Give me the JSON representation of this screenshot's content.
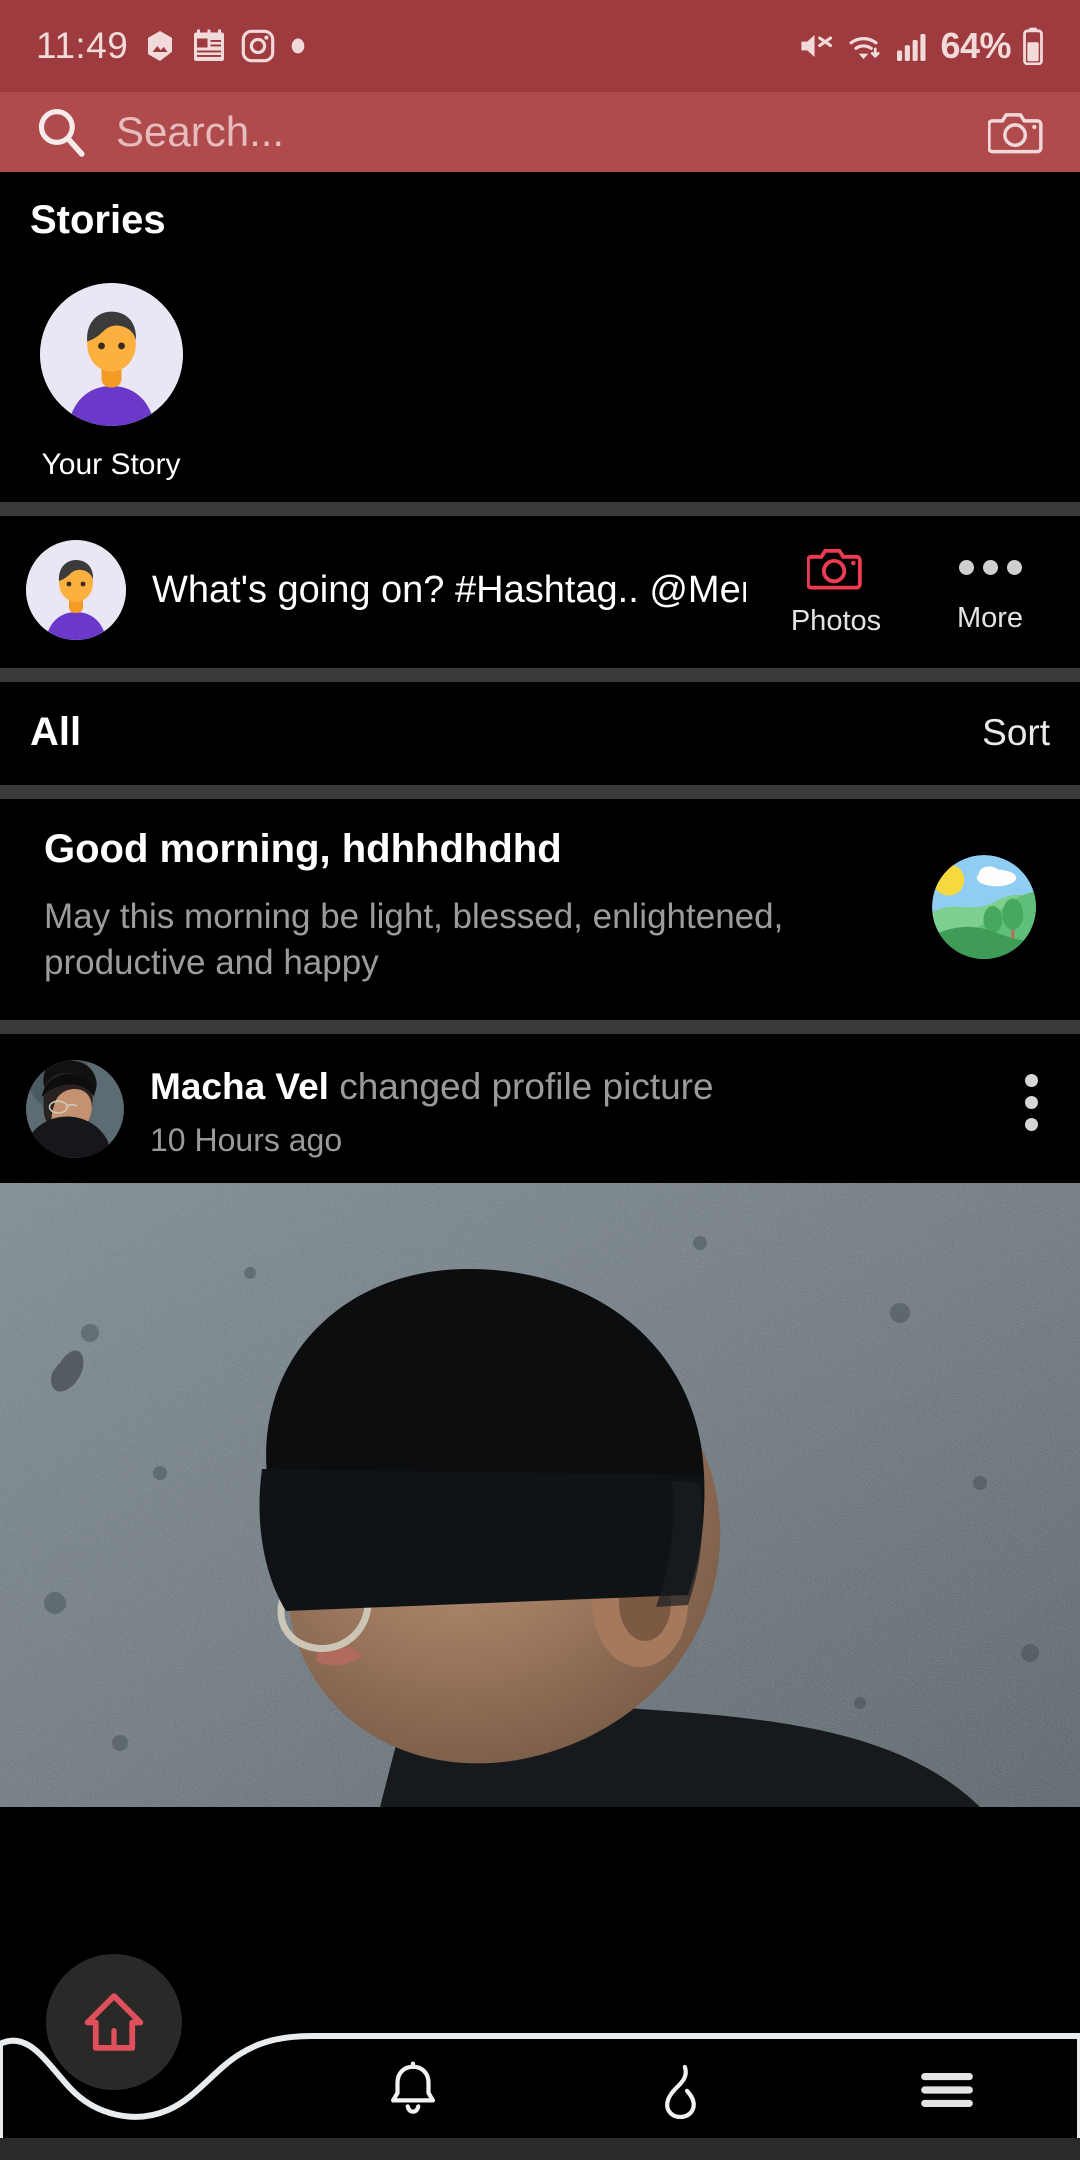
{
  "status_bar": {
    "time": "11:49",
    "battery_text": "64%",
    "left_icons": [
      "gallery-app-icon",
      "notes-app-icon",
      "instagram-app-icon",
      "dot-indicator-icon"
    ],
    "right_icons": [
      "mute-icon",
      "wifi-icon",
      "cellular-signal-icon",
      "battery-icon"
    ],
    "background_color": "#9e3b3e"
  },
  "header": {
    "search_placeholder": "Search...",
    "search_icon": "search-icon",
    "camera_icon": "camera-icon",
    "background_color": "#af4b4c"
  },
  "stories": {
    "title": "Stories",
    "items": [
      {
        "label": "Your Story",
        "avatar": "user-avatar-illustration"
      }
    ]
  },
  "compose": {
    "avatar": "user-avatar-illustration",
    "prompt": "What's going on? #Hashtag.. @Mention.",
    "actions": [
      {
        "label": "Photos",
        "icon": "camera-icon",
        "color": "#ef3b52"
      },
      {
        "label": "More",
        "icon": "more-horizontal-icon"
      }
    ]
  },
  "filter_bar": {
    "active_filter": "All",
    "sort_label": "Sort"
  },
  "greeting_card": {
    "title": "Good morning, hdhhdhdhd",
    "subtitle": "May this morning be light, blessed, enlightened, productive and happy",
    "illustration": "landscape-sun-hills-icon"
  },
  "activity": {
    "user_name": "Macha Vel",
    "action_text": "changed profile picture",
    "timestamp": "10 Hours ago",
    "menu_icon": "more-vertical-icon",
    "avatar": "profile-photo"
  },
  "post_photo": {
    "alt": "person-wearing-beanie-and-glasses-photo"
  },
  "bottom_nav": {
    "items": [
      {
        "name": "home",
        "icon": "home-icon",
        "active": true,
        "color": "#e0505c"
      },
      {
        "name": "notifications",
        "icon": "bell-icon",
        "active": false
      },
      {
        "name": "trending",
        "icon": "flame-icon",
        "active": false
      },
      {
        "name": "menu",
        "icon": "hamburger-menu-icon",
        "active": false
      }
    ]
  }
}
